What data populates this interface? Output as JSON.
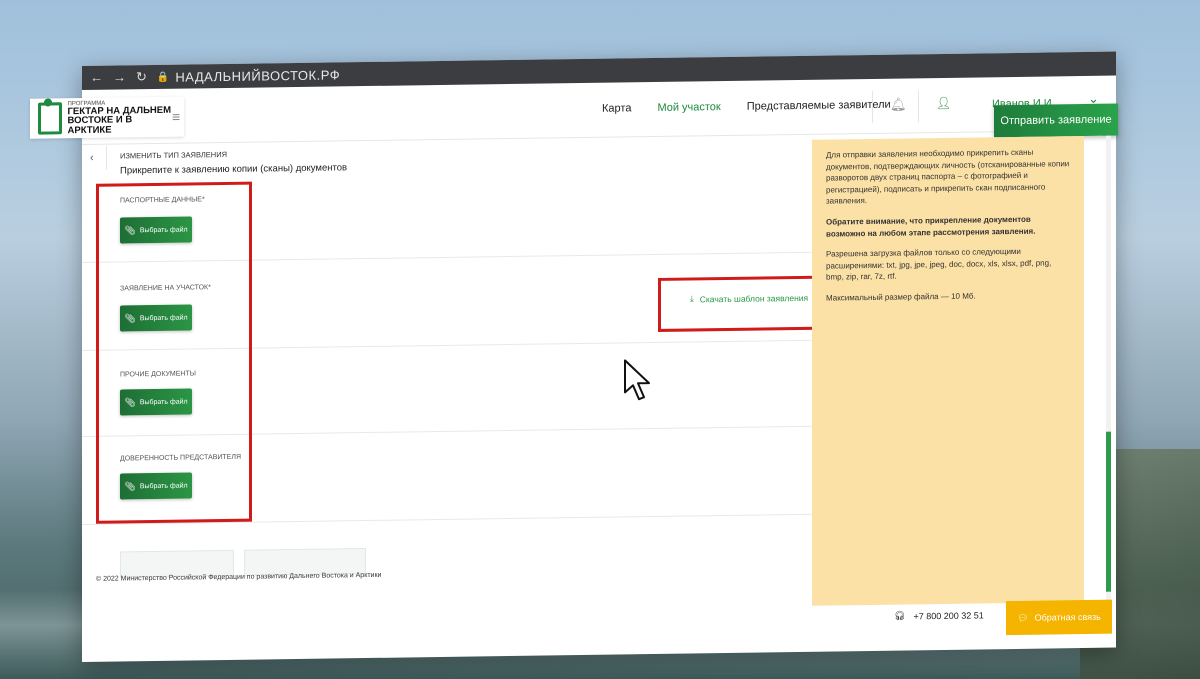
{
  "browser": {
    "url": "НАДАЛЬНИЙВОСТОК.РФ"
  },
  "site": {
    "logo_small": "ПРОГРАММА",
    "logo_line1": "ГЕКТАР НА ДАЛЬНЕМ",
    "logo_line2": "ВОСТОКЕ И В АРКТИКЕ",
    "nav": {
      "map": "Карта",
      "my_plot": "Мой участок",
      "represented": "Представляемые заявители"
    },
    "user_name": "Иванов И.И.",
    "send_button": "Отправить заявление"
  },
  "form": {
    "change_type": "ИЗМЕНИТЬ ТИП ЗАЯВЛЕНИЯ",
    "heading": "Прикрепите к заявлению копии (сканы) документов",
    "sections": [
      {
        "label": "ПАСПОРТНЫЕ ДАННЫЕ*",
        "button": "Выбрать файл"
      },
      {
        "label": "ЗАЯВЛЕНИЕ НА УЧАСТОК*",
        "button": "Выбрать файл"
      },
      {
        "label": "ПРОЧИЕ ДОКУМЕНТЫ",
        "button": "Выбрать файл"
      },
      {
        "label": "ДОВЕРЕННОСТЬ ПРЕДСТАВИТЕЛЯ",
        "button": "Выбрать файл"
      }
    ],
    "download_template": "Скачать шаблон заявления"
  },
  "info": {
    "p1": "Для отправки заявления необходимо прикрепить сканы документов, подтверждающих личность (отсканированные копии разворотов двух страниц паспорта – с фотографией и регистрацией), подписать и прикрепить скан подписанного заявления.",
    "p2": "Обратите внимание, что прикрепление документов возможно на любом этапе рассмотрения заявления.",
    "p3": "Разрешена загрузка файлов только со следующими расширениями: txt, jpg, jpe, jpeg, doc, docx, xls, xlsx, pdf, png, bmp, zip, rar, 7z, rtf.",
    "p4": "Максимальный размер файла — 10 Мб."
  },
  "footer": {
    "copyright": "© 2022 Министерство Российской Федерации по развитию Дальнего Востока и Арктики",
    "phone": "+7 800 200 32 51",
    "feedback": "Обратная связь"
  },
  "colors": {
    "brand_green": "#1e8a3d",
    "highlight_red": "#d11a1a",
    "info_bg": "#fce1a6",
    "feedback_yellow": "#f4b400"
  }
}
